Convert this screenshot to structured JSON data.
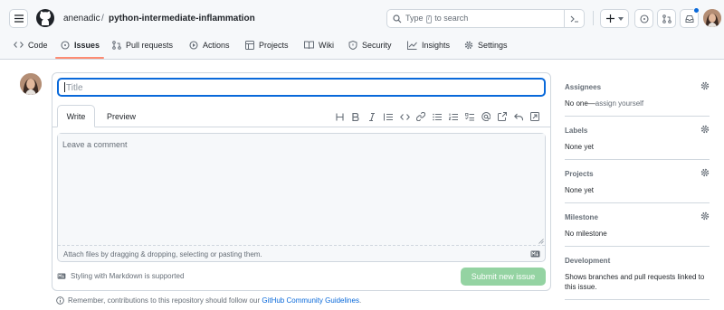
{
  "header": {
    "owner": "anenadic",
    "separator": "/",
    "repo": "python-intermediate-inflammation",
    "search_prefix": "Type",
    "search_key": "/",
    "search_suffix": "to search",
    "colors": {
      "notification_dot": "#0969da",
      "active_tab_underline": "#fd8c73"
    }
  },
  "nav": {
    "tabs": [
      {
        "label": "Code",
        "icon": "code-icon"
      },
      {
        "label": "Issues",
        "icon": "issue-opened-icon",
        "active": true
      },
      {
        "label": "Pull requests",
        "icon": "git-pull-request-icon"
      },
      {
        "label": "Actions",
        "icon": "play-icon"
      },
      {
        "label": "Projects",
        "icon": "table-icon"
      },
      {
        "label": "Wiki",
        "icon": "book-icon"
      },
      {
        "label": "Security",
        "icon": "shield-icon"
      },
      {
        "label": "Insights",
        "icon": "graph-icon"
      },
      {
        "label": "Settings",
        "icon": "gear-icon"
      }
    ]
  },
  "form": {
    "title_placeholder": "Title",
    "tab_write": "Write",
    "tab_preview": "Preview",
    "comment_placeholder": "Leave a comment",
    "attach_hint": "Attach files by dragging & dropping, selecting or pasting them.",
    "markdown_note": "Styling with Markdown is supported",
    "submit_label": "Submit new issue",
    "remember_prefix": "Remember, contributions to this repository should follow our",
    "guidelines_link": "GitHub Community Guidelines",
    "remember_suffix": ".",
    "submit_color": "#94d3a2"
  },
  "sidebar": {
    "assignees_title": "Assignees",
    "assignees_value": "No one—",
    "assign_yourself": "assign yourself",
    "labels_title": "Labels",
    "labels_value": "None yet",
    "projects_title": "Projects",
    "projects_value": "None yet",
    "milestone_title": "Milestone",
    "milestone_value": "No milestone",
    "development_title": "Development",
    "development_value": "Shows branches and pull requests linked to this issue."
  }
}
